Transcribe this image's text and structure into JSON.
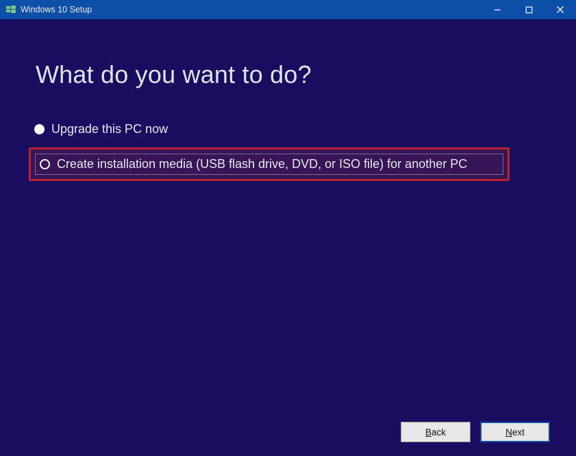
{
  "window": {
    "title": "Windows 10 Setup"
  },
  "page": {
    "heading": "What do you want to do?"
  },
  "options": {
    "upgrade": {
      "label": "Upgrade this PC now",
      "selected": false
    },
    "create_media": {
      "label": "Create installation media (USB flash drive, DVD, or ISO file) for another PC",
      "selected": true,
      "highlighted": true
    }
  },
  "buttons": {
    "back": {
      "label": "Back",
      "mnemonic": "B"
    },
    "next": {
      "label": "Next",
      "mnemonic": "N"
    }
  },
  "colors": {
    "titlebar": "#0d4ea8",
    "body_bg": "#1a0c5e",
    "highlight_border": "#b9232d"
  }
}
